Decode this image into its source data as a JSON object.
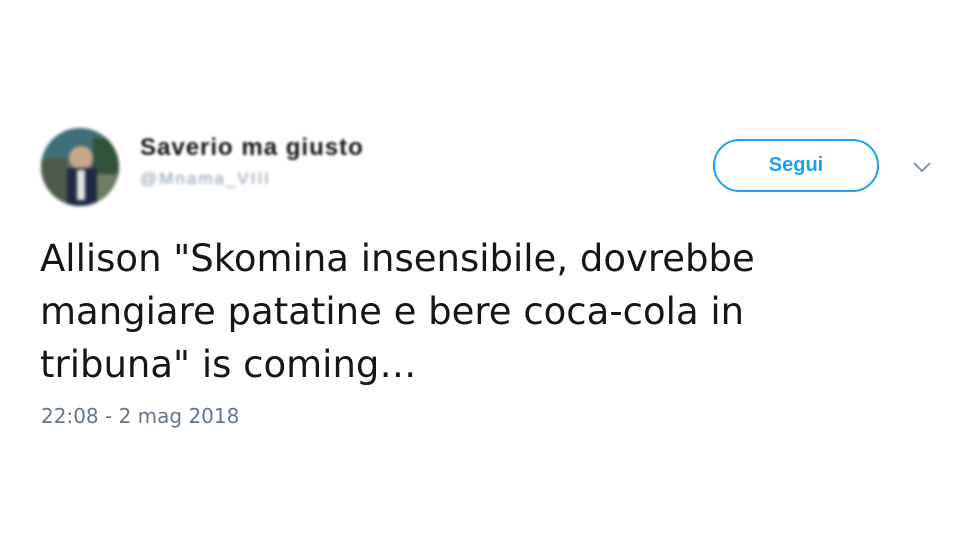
{
  "author": {
    "display_name": "Saverio ma giusto",
    "handle": "@Mnama_VIII",
    "avatar_icon": "user-avatar-photo"
  },
  "follow_button": {
    "label": "Segui",
    "color": "#1da1f2"
  },
  "menu_icon": "chevron-down-icon",
  "tweet": {
    "lines": [
      "Allison \"Skomina insensibile, dovrebbe",
      "mangiare patatine e bere coca-cola in",
      "tribuna\" is coming…"
    ],
    "timestamp": "22:08 - 2 mag 2018"
  }
}
